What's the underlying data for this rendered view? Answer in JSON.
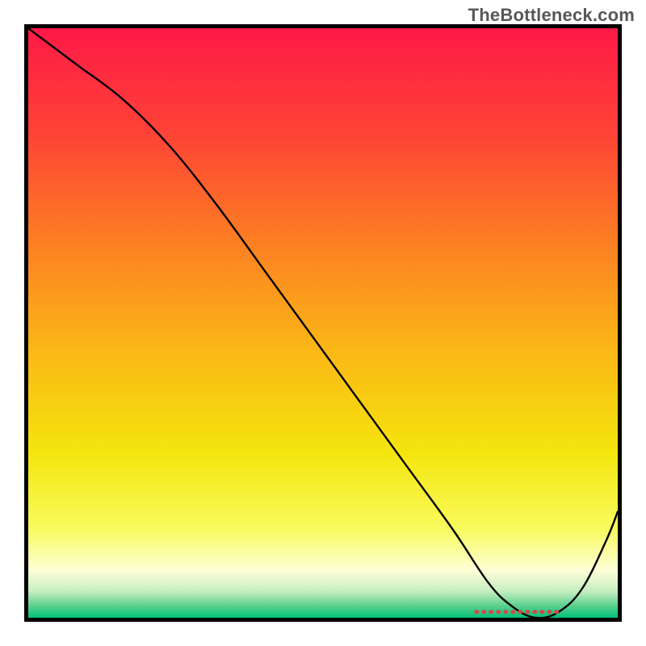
{
  "watermark": "TheBottleneck.com",
  "chart_data": {
    "type": "line",
    "title": "",
    "xlabel": "",
    "ylabel": "",
    "xlim": [
      0,
      100
    ],
    "ylim": [
      0,
      100
    ],
    "grid": false,
    "series": [
      {
        "name": "bottleneck-curve",
        "color": "#000000",
        "x": [
          0,
          8,
          16,
          24,
          32,
          40,
          48,
          56,
          64,
          72,
          78,
          82,
          86,
          90,
          94,
          98,
          100
        ],
        "y": [
          100,
          94,
          88,
          80,
          70,
          59,
          48,
          37,
          26,
          15,
          6,
          2,
          0,
          1,
          5,
          13,
          18
        ]
      },
      {
        "name": "optimal-range-marker",
        "style": "dotted",
        "color": "#d24a49",
        "x": [
          76,
          90
        ],
        "y": [
          1,
          1
        ]
      }
    ],
    "background_gradient": {
      "direction": "vertical",
      "stops": [
        {
          "pos": 0.0,
          "color": "#fe1a47"
        },
        {
          "pos": 0.18,
          "color": "#fe4336"
        },
        {
          "pos": 0.36,
          "color": "#fc7e23"
        },
        {
          "pos": 0.55,
          "color": "#fbb816"
        },
        {
          "pos": 0.72,
          "color": "#f4e50d"
        },
        {
          "pos": 0.85,
          "color": "#f8fb5e"
        },
        {
          "pos": 0.92,
          "color": "#fdfed7"
        },
        {
          "pos": 0.955,
          "color": "#c6eec0"
        },
        {
          "pos": 0.978,
          "color": "#62d291"
        },
        {
          "pos": 1.0,
          "color": "#00c178"
        }
      ]
    }
  }
}
